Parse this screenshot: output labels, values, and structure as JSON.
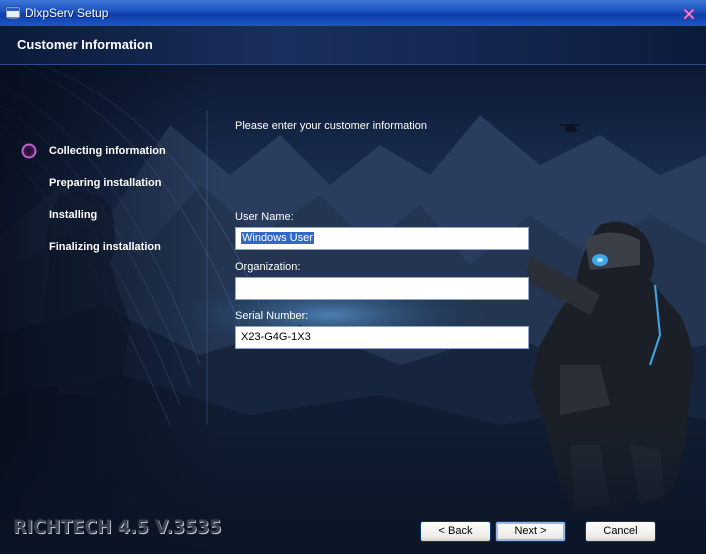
{
  "window": {
    "title": "DlxpServ Setup",
    "close_icon": "close-icon"
  },
  "header": {
    "title": "Customer Information"
  },
  "steps": [
    {
      "label": "Collecting information",
      "active": true
    },
    {
      "label": "Preparing installation",
      "active": false
    },
    {
      "label": "Installing",
      "active": false
    },
    {
      "label": "Finalizing installation",
      "active": false
    }
  ],
  "form": {
    "prompt": "Please enter your customer information",
    "user_name": {
      "label": "User Name:",
      "value": "Windows User"
    },
    "organization": {
      "label": "Organization:",
      "value": ""
    },
    "serial": {
      "label": "Serial Number:",
      "value": "X23-G4G-1X3"
    }
  },
  "footer": {
    "brand": "RICHTECH 4.5 V.3535",
    "back_label": "< Back",
    "next_label": "Next >",
    "cancel_label": "Cancel"
  },
  "colors": {
    "accent": "#3169c6",
    "step_marker": "#b04ab8",
    "title_bar": "#1a4fbf"
  }
}
